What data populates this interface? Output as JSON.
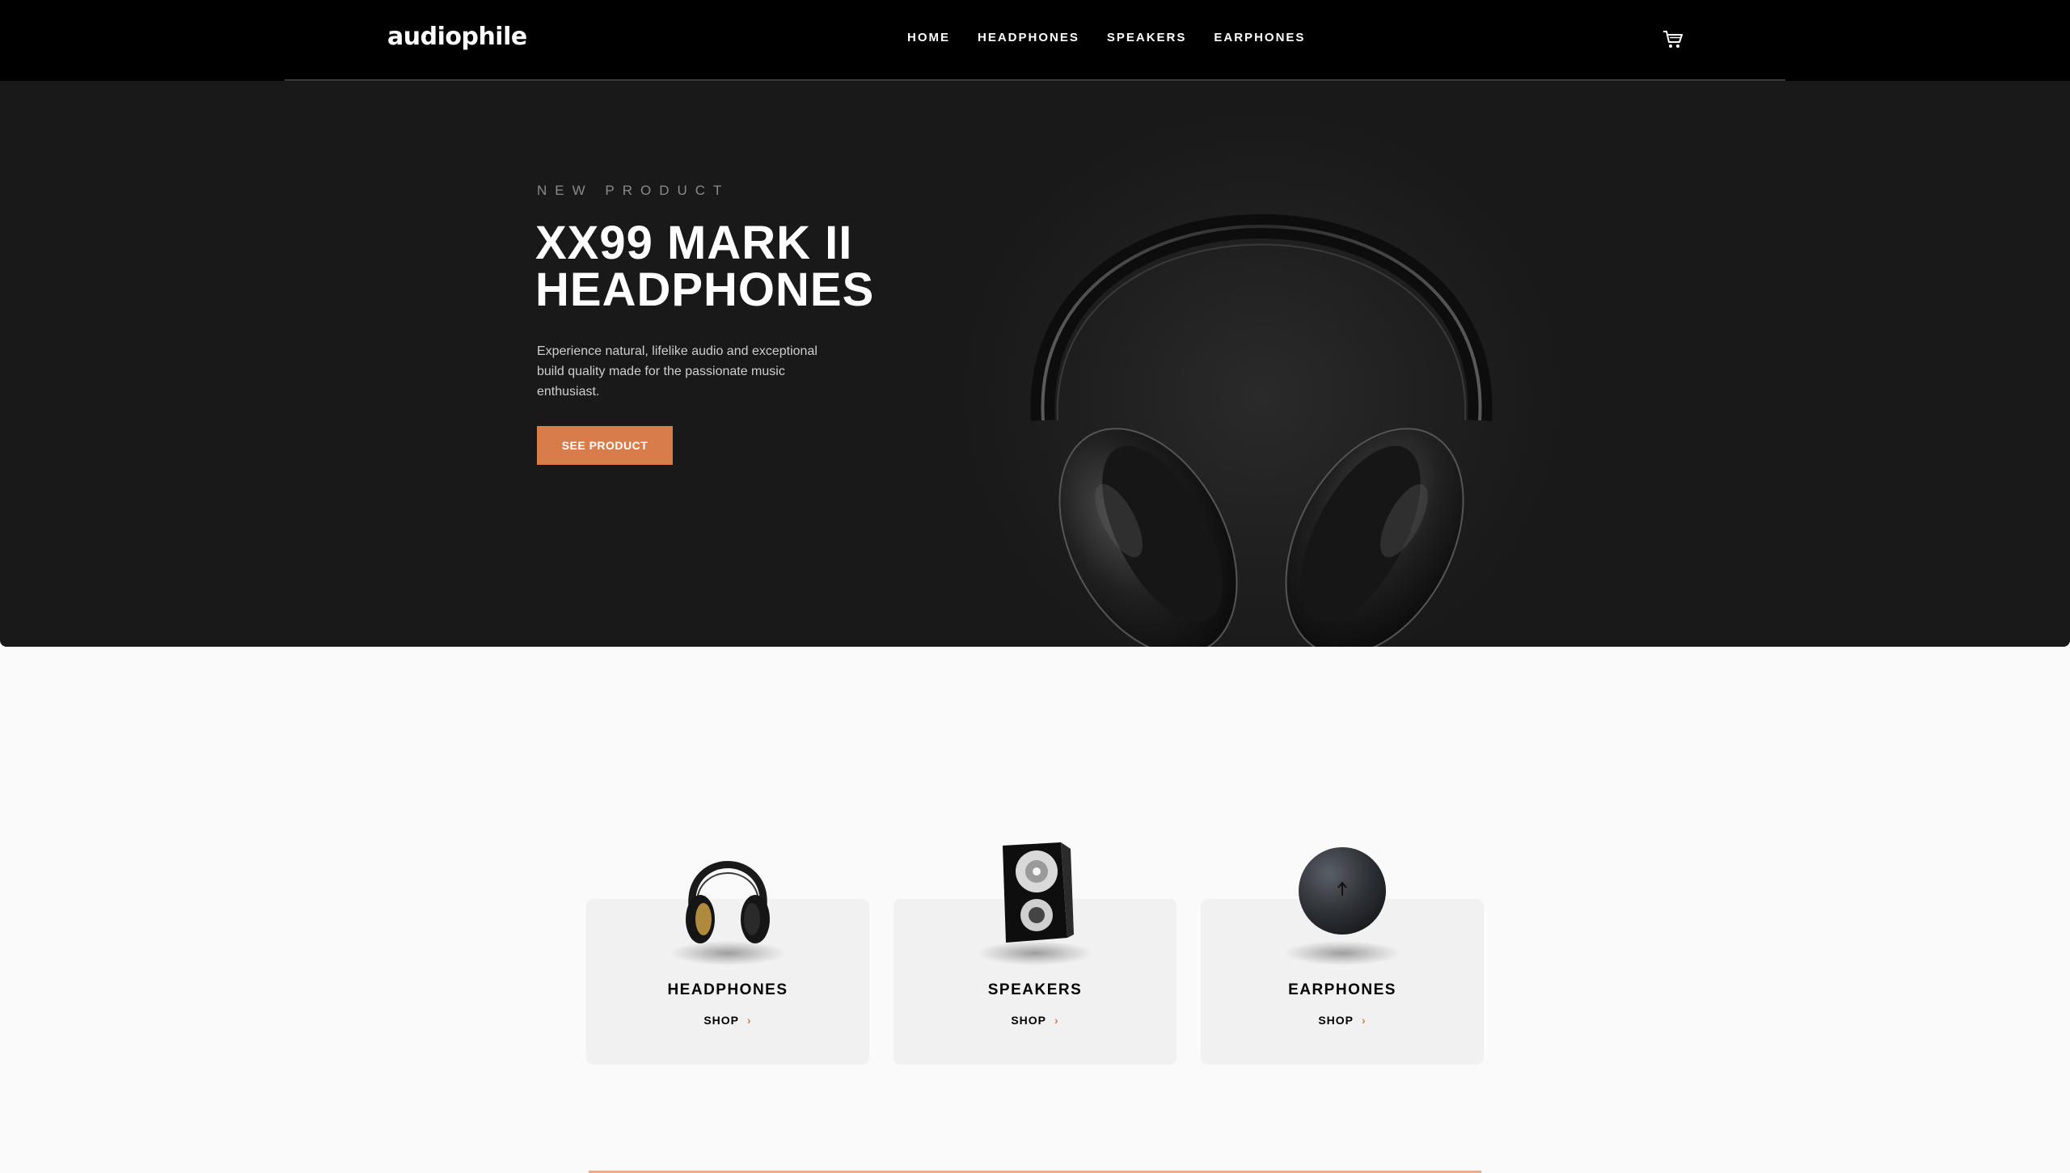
{
  "header": {
    "logo": "audiophile",
    "nav": [
      "HOME",
      "HEADPHONES",
      "SPEAKERS",
      "EARPHONES"
    ],
    "cart_icon": "cart-icon"
  },
  "hero": {
    "overline": "NEW PRODUCT",
    "title": "XX99 MARK II HEADPHONES",
    "description": "Experience natural, lifelike audio and exceptional build quality made for the passionate music enthusiast.",
    "cta": "SEE PRODUCT"
  },
  "categories": [
    {
      "title": "HEADPHONES",
      "shop": "SHOP",
      "icon": "headphones-icon"
    },
    {
      "title": "SPEAKERS",
      "shop": "SHOP",
      "icon": "speaker-icon"
    },
    {
      "title": "EARPHONES",
      "shop": "SHOP",
      "icon": "earphones-case-icon"
    }
  ],
  "colors": {
    "accent": "#d87d4a",
    "hero_bg": "#191919",
    "header_bg": "#000000",
    "card_bg": "#f1f1f1"
  }
}
